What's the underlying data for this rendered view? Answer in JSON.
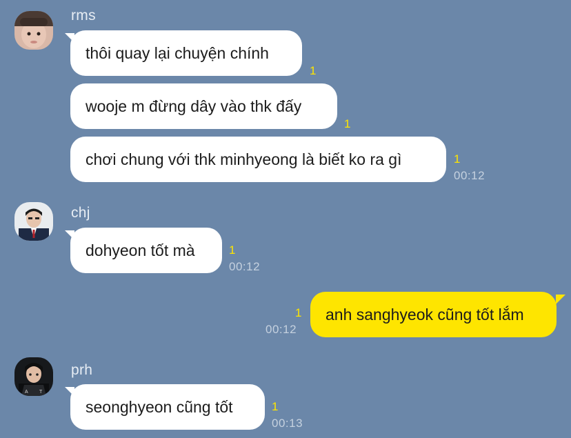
{
  "senders": {
    "rms": "rms",
    "chj": "chj",
    "prh": "prh"
  },
  "messages": [
    {
      "text": "thôi quay lại chuyện chính",
      "unread": "1",
      "time": ""
    },
    {
      "text": "wooje m đừng dây vào thk đấy",
      "unread": "1",
      "time": ""
    },
    {
      "text": "chơi chung với thk minhyeong là biết ko ra gì",
      "unread": "1",
      "time": "00:12"
    },
    {
      "text": "dohyeon tốt mà",
      "unread": "1",
      "time": "00:12"
    },
    {
      "text": "anh sanghyeok cũng tốt lắm",
      "unread": "1",
      "time": "00:12"
    },
    {
      "text": "seonghyeon cũng tốt",
      "unread": "1",
      "time": "00:13"
    }
  ],
  "colors": {
    "background": "#6b87a9",
    "incoming_bubble": "#ffffff",
    "outgoing_bubble": "#fee500",
    "unread_count": "#fee500"
  },
  "icons": {
    "rms_avatar": "profile-photo",
    "chj_avatar": "profile-photo",
    "prh_avatar": "profile-photo"
  }
}
